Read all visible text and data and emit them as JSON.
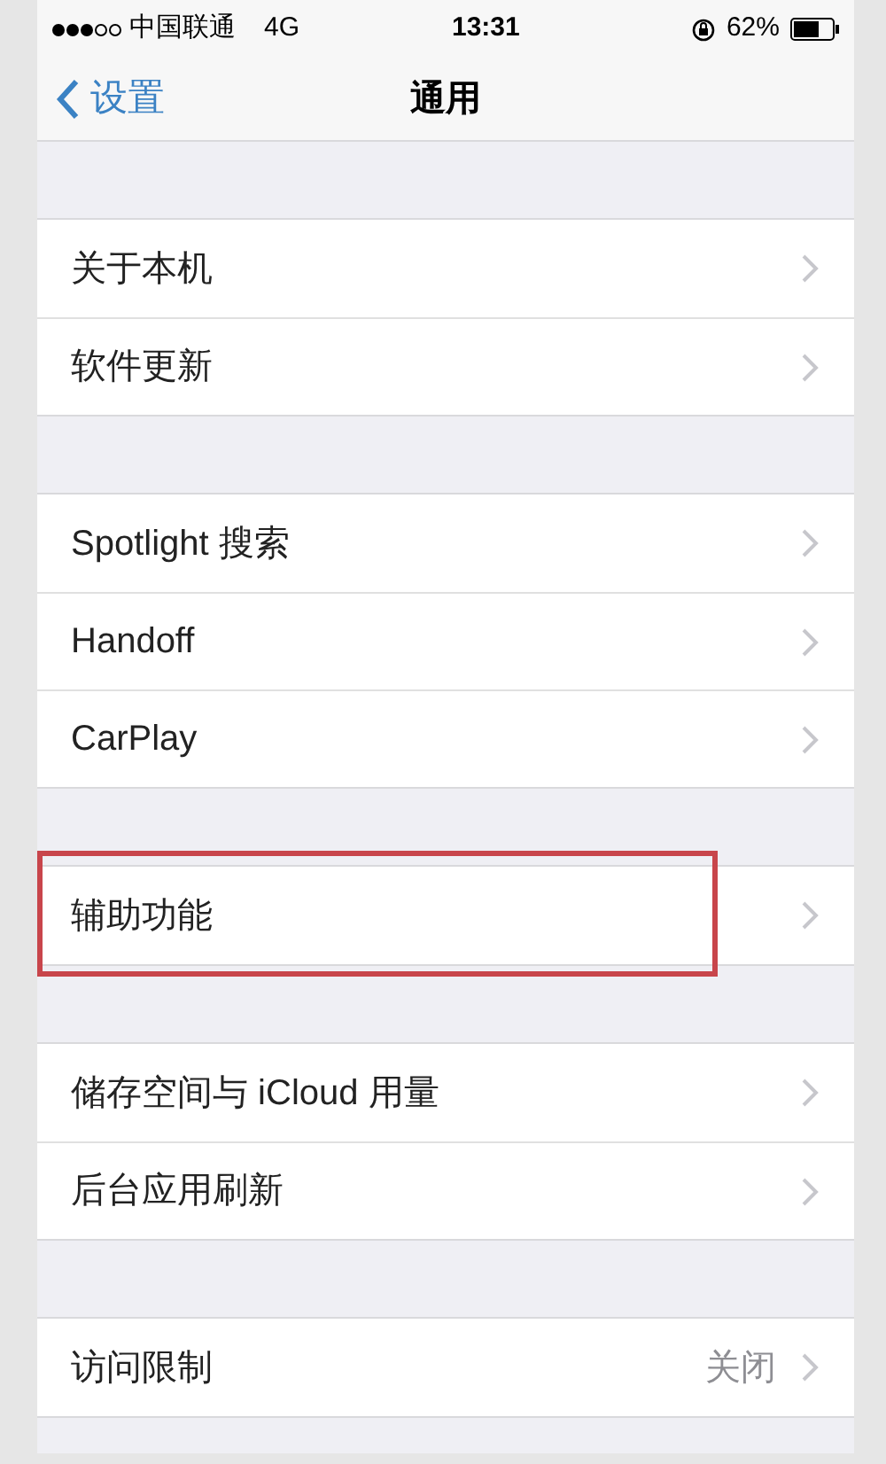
{
  "status_bar": {
    "carrier": "中国联通",
    "network": "4G",
    "time": "13:31",
    "battery": "62%"
  },
  "nav_bar": {
    "back": "设置",
    "title": "通用"
  },
  "groups": [
    {
      "items": [
        {
          "label": "关于本机",
          "highlighted": false
        },
        {
          "label": "软件更新",
          "highlighted": false
        }
      ]
    },
    {
      "items": [
        {
          "label": "Spotlight 搜索",
          "highlighted": false
        },
        {
          "label": "Handoff",
          "highlighted": false
        },
        {
          "label": "CarPlay",
          "highlighted": false
        }
      ]
    },
    {
      "items": [
        {
          "label": "辅助功能",
          "highlighted": true
        }
      ]
    },
    {
      "items": [
        {
          "label": "储存空间与 iCloud 用量",
          "highlighted": false
        },
        {
          "label": "后台应用刷新",
          "highlighted": false
        }
      ]
    },
    {
      "items": [
        {
          "label": "访问限制",
          "value": "关闭",
          "highlighted": false
        }
      ]
    }
  ]
}
